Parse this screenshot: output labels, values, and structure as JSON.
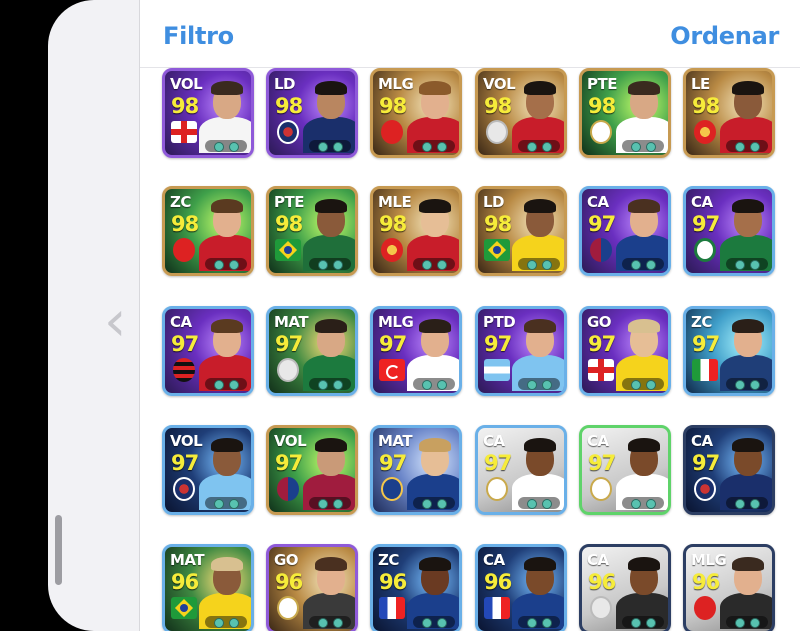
{
  "header": {
    "filter_label": "Filtro",
    "sort_label": "Ordenar"
  },
  "side": {
    "back_icon": "chevron-left-icon"
  },
  "cards": [
    {
      "pos": "VOL",
      "rating": "98",
      "badge": "flag-eng",
      "bg": "bg-purple",
      "border": "b-purple",
      "skin": "#d8a885",
      "hair": "#3a2a1f",
      "kit": "#f5f5f5"
    },
    {
      "pos": "LD",
      "rating": "98",
      "badge": "crest-psg",
      "bg": "bg-purple",
      "border": "b-purple",
      "skin": "#b98660",
      "hair": "#1a1410",
      "kit": "#1a2f6b"
    },
    {
      "pos": "MLG",
      "rating": "98",
      "badge": "crest-liv",
      "bg": "bg-gold",
      "border": "b-gold",
      "skin": "#e2b08e",
      "hair": "#8b5a2b",
      "kit": "#c81d2a"
    },
    {
      "pos": "VOL",
      "rating": "98",
      "badge": "crest-grey",
      "bg": "bg-gold",
      "border": "b-gold",
      "skin": "#a56f4a",
      "hair": "#1a1410",
      "kit": "#c81d2a"
    },
    {
      "pos": "PTE",
      "rating": "98",
      "badge": "crest-mad",
      "bg": "bg-green",
      "border": "b-gold",
      "skin": "#d8a885",
      "hair": "#3a2a1f",
      "kit": "#ffffff"
    },
    {
      "pos": "LE",
      "rating": "98",
      "badge": "crest-mu",
      "bg": "bg-gold",
      "border": "b-gold",
      "skin": "#8a5a3a",
      "hair": "#1a1410",
      "kit": "#c81d2a"
    },
    {
      "pos": "ZC",
      "rating": "98",
      "badge": "crest-bay",
      "bg": "bg-green",
      "border": "b-gold",
      "skin": "#e2b08e",
      "hair": "#5a3a20",
      "kit": "#c81d2a"
    },
    {
      "pos": "PTE",
      "rating": "98",
      "badge": "flag-bra",
      "bg": "bg-green",
      "border": "b-gold",
      "skin": "#8a5a3a",
      "hair": "#1a1410",
      "kit": "#1f6f3a"
    },
    {
      "pos": "MLE",
      "rating": "98",
      "badge": "crest-mu",
      "bg": "bg-gold",
      "border": "b-gold",
      "skin": "#e6be96",
      "hair": "#1a1410",
      "kit": "#c81d2a"
    },
    {
      "pos": "LD",
      "rating": "98",
      "badge": "flag-bra",
      "bg": "bg-gold",
      "border": "b-gold",
      "skin": "#8a5a3a",
      "hair": "#1a1410",
      "kit": "#f5d31c"
    },
    {
      "pos": "CA",
      "rating": "97",
      "badge": "crest-fcb",
      "bg": "bg-purple",
      "border": "b-blue",
      "skin": "#e2b08e",
      "hair": "#4a3020",
      "kit": "#1b3f8c"
    },
    {
      "pos": "CA",
      "rating": "97",
      "badge": "crest-pal",
      "bg": "bg-purple",
      "border": "b-blue",
      "skin": "#a56f4a",
      "hair": "#1a1410",
      "kit": "#1c7a3e"
    },
    {
      "pos": "CA",
      "rating": "97",
      "badge": "crest-fla",
      "bg": "bg-purple",
      "border": "b-blue",
      "skin": "#e2b08e",
      "hair": "#5a3a20",
      "kit": "#c81d2a"
    },
    {
      "pos": "MAT",
      "rating": "97",
      "badge": "crest-grey",
      "bg": "bg-stadium",
      "border": "b-blue",
      "skin": "#d8a885",
      "hair": "#2a1f18",
      "kit": "#1c7a3e"
    },
    {
      "pos": "MLG",
      "rating": "97",
      "badge": "flag-tur",
      "bg": "bg-purple",
      "border": "b-blue",
      "skin": "#e2b08e",
      "hair": "#2a1f18",
      "kit": "#ffffff"
    },
    {
      "pos": "PTD",
      "rating": "97",
      "badge": "flag-arg",
      "bg": "bg-purple",
      "border": "b-blue",
      "skin": "#e2b08e",
      "hair": "#4a3020",
      "kit": "#7fc4f0"
    },
    {
      "pos": "GO",
      "rating": "97",
      "badge": "flag-eng",
      "bg": "bg-purple",
      "border": "b-blue",
      "skin": "#e6be96",
      "hair": "#d8c090",
      "kit": "#f5d31c"
    },
    {
      "pos": "ZC",
      "rating": "97",
      "badge": "flag-ita",
      "bg": "bg-cyan",
      "border": "b-blue",
      "skin": "#e2b08e",
      "hair": "#2a1f18",
      "kit": "#1f3e78"
    },
    {
      "pos": "VOL",
      "rating": "97",
      "badge": "crest-psg",
      "bg": "bg-dark",
      "border": "b-blue",
      "skin": "#8a5a3a",
      "hair": "#1a1410",
      "kit": "#7fc4f0"
    },
    {
      "pos": "VOL",
      "rating": "97",
      "badge": "crest-fcb",
      "bg": "bg-green",
      "border": "b-gold",
      "skin": "#c99a78",
      "hair": "#1a1410",
      "kit": "#a01c3e"
    },
    {
      "pos": "MAT",
      "rating": "97",
      "badge": "crest-ali",
      "bg": "bg-blue",
      "border": "b-blue",
      "skin": "#e6be96",
      "hair": "#c8a060",
      "kit": "#1b3f8c"
    },
    {
      "pos": "CA",
      "rating": "97",
      "badge": "crest-mad",
      "bg": "bg-light",
      "border": "b-blue",
      "skin": "#7a4a2a",
      "hair": "#1a1410",
      "kit": "#ffffff"
    },
    {
      "pos": "CA",
      "rating": "97",
      "badge": "crest-mad",
      "bg": "bg-light",
      "border": "b-green",
      "skin": "#7a4a2a",
      "hair": "#1a1410",
      "kit": "#ffffff"
    },
    {
      "pos": "CA",
      "rating": "97",
      "badge": "crest-psg",
      "bg": "bg-dark",
      "border": "b-dark",
      "skin": "#7a4a2a",
      "hair": "#1a1410",
      "kit": "#1a2f6b"
    },
    {
      "pos": "MAT",
      "rating": "96",
      "badge": "flag-bra",
      "bg": "bg-stadium",
      "border": "b-blue",
      "skin": "#8a5a3a",
      "hair": "#d8c090",
      "kit": "#f5d31c"
    },
    {
      "pos": "GO",
      "rating": "96",
      "badge": "crest-mad",
      "bg": "bg-gold",
      "border": "b-purple",
      "skin": "#e2b08e",
      "hair": "#4a3020",
      "kit": "#3a3a3a"
    },
    {
      "pos": "ZC",
      "rating": "96",
      "badge": "flag-fra",
      "bg": "bg-dark",
      "border": "b-blue",
      "skin": "#6a3a22",
      "hair": "#1a1410",
      "kit": "#1b3f8c"
    },
    {
      "pos": "CA",
      "rating": "96",
      "badge": "flag-fra",
      "bg": "bg-dark",
      "border": "b-blue",
      "skin": "#7a4a2a",
      "hair": "#1a1410",
      "kit": "#1b3f8c"
    },
    {
      "pos": "CA",
      "rating": "96",
      "badge": "crest-grey",
      "bg": "bg-light",
      "border": "b-dark",
      "skin": "#7a4a2a",
      "hair": "#1a1410",
      "kit": "#2a2a2a"
    },
    {
      "pos": "MLG",
      "rating": "96",
      "badge": "crest-ars",
      "bg": "bg-light",
      "border": "b-dark",
      "skin": "#e2b08e",
      "hair": "#3a2a1f",
      "kit": "#2a2a2a"
    }
  ]
}
